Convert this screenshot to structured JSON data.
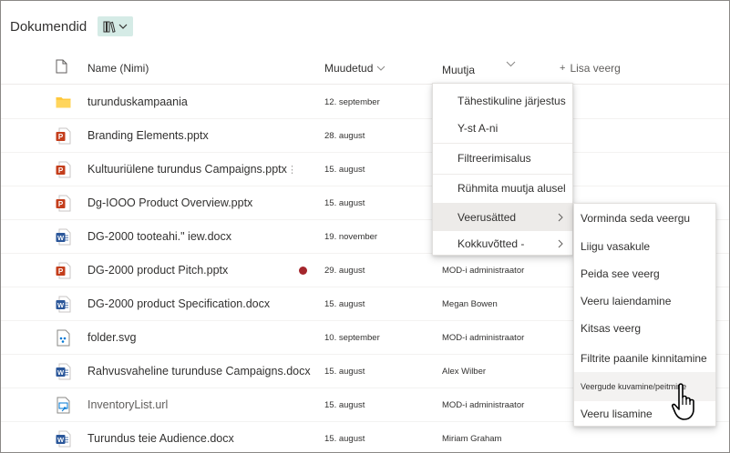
{
  "header": {
    "title": "Dokumendid",
    "view_icon": "library-icon"
  },
  "columns": {
    "name": "Name (Nimi)",
    "modified": "Muudetud",
    "modified_by": "Muutja",
    "add": "Lisa veerg"
  },
  "files": [
    {
      "name": "turunduskampaania",
      "type": "folder",
      "modified": "12. september",
      "by": ""
    },
    {
      "name": "Branding Elements.pptx",
      "type": "pptx",
      "modified": "28. august",
      "by": ""
    },
    {
      "name": "Kultuuriülene turundus Campaigns.pptx",
      "type": "pptx",
      "modified": "15. august",
      "by": ""
    },
    {
      "name": "Dg-IOOO Product Overview.pptx",
      "type": "pptx",
      "modified": "15. august",
      "by": ""
    },
    {
      "name": "DG-2000 tooteahi.\" iew.docx",
      "type": "docx",
      "modified": "19. november",
      "by": ""
    },
    {
      "name": "DG-2000 product Pitch.pptx",
      "type": "pptx",
      "modified": "29. august",
      "by": "MOD-i administraator"
    },
    {
      "name": "DG-2000 product Specification.docx",
      "type": "docx",
      "modified": "15. august",
      "by": "Megan Bowen"
    },
    {
      "name": "folder.svg",
      "type": "svg",
      "modified": "10. september",
      "by": "MOD-i administraator"
    },
    {
      "name": "Rahvusvaheline turunduse Campaigns.docx",
      "type": "docx",
      "modified": "15. august",
      "by": "Alex Wilber"
    },
    {
      "name": "InventoryList.url",
      "type": "url",
      "modified": "15. august",
      "by": "MOD-i administraator"
    },
    {
      "name": "Turundus teie Audience.docx",
      "type": "docx",
      "modified": "15. august",
      "by": "Miriam Graham"
    }
  ],
  "column_menu": {
    "items": [
      "Tähestikuline järjestus",
      "Y-st A-ni",
      "Filtreerimisalus",
      "Rühmita muutja alusel",
      "Veerusätted",
      "Kokkuvõtted -"
    ]
  },
  "settings_menu": {
    "items": [
      "Vorminda seda veergu",
      "Liigu vasakule",
      "Peida see veerg",
      "Veeru laiendamine",
      "Kitsas veerg",
      "Filtrite paanile kinnitamine",
      "Veergude kuvamine/peitmine",
      "Veeru lisamine"
    ]
  },
  "colors": {
    "view_button_bg": "#d5ebe6",
    "ppt_red": "#c43e1c",
    "word_blue": "#2b579a",
    "folder_yellow": "#ffc83d",
    "alert_red": "#a4262c"
  }
}
